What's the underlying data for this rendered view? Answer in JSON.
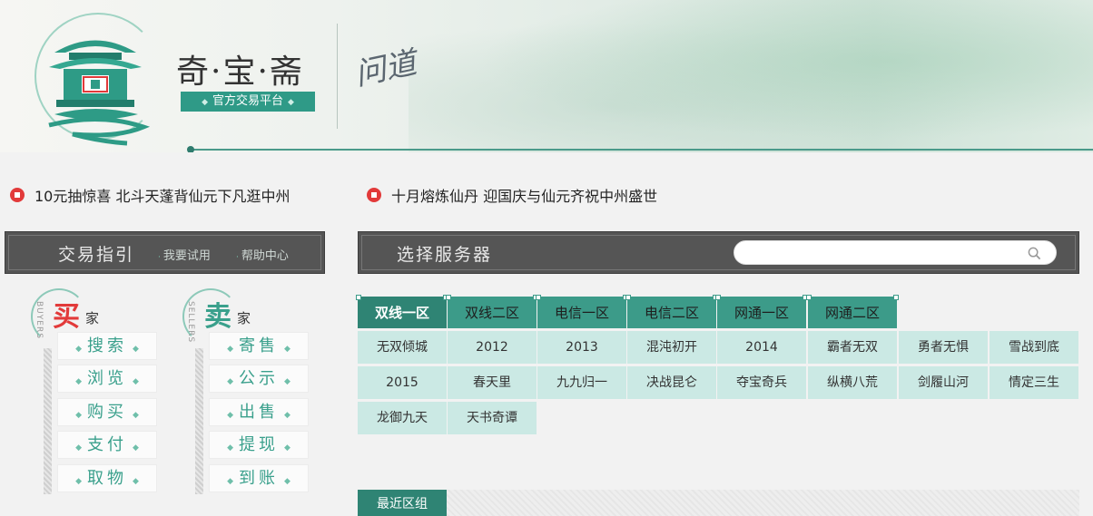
{
  "header": {
    "brand_title": "奇·宝·斋",
    "brand_subtitle": "官方交易平台",
    "partner_logo_text": "问道",
    "logo_icon": "pavilion-icon"
  },
  "news": [
    {
      "text": "10元抽惊喜 北斗天蓬背仙元下凡逛中州"
    },
    {
      "text": "十月熔炼仙丹 迎国庆与仙元齐祝中州盛世"
    }
  ],
  "guide": {
    "title": "交易指引",
    "links": [
      "我要试用",
      "帮助中心"
    ],
    "buyer": {
      "big": "买",
      "small": "家",
      "eng": "BUYERS",
      "items": [
        "搜索",
        "浏览",
        "购买",
        "支付",
        "取物"
      ]
    },
    "seller": {
      "big": "卖",
      "small": "家",
      "eng": "SELLERS",
      "items": [
        "寄售",
        "公示",
        "出售",
        "提现",
        "到账"
      ]
    }
  },
  "server": {
    "title": "选择服务器",
    "search_placeholder": "",
    "tabs": [
      "双线一区",
      "双线二区",
      "电信一区",
      "电信二区",
      "网通一区",
      "网通二区"
    ],
    "active_tab": 0,
    "rows": [
      [
        "无双倾城",
        "2012",
        "2013",
        "混沌初开",
        "2014",
        "霸者无双",
        "勇者无惧",
        "雪战到底"
      ],
      [
        "2015",
        "春天里",
        "九九归一",
        "决战昆仑",
        "夺宝奇兵",
        "纵横八荒",
        "剑履山河",
        "情定三生"
      ],
      [
        "龙御九天",
        "天书奇谭"
      ]
    ],
    "recent_label": "最近区组"
  },
  "colors": {
    "accent": "#2f8474",
    "tab": "#3c9b89",
    "cell": "#cbe9e4",
    "bar": "#555555",
    "bullet": "#e23a3a"
  }
}
